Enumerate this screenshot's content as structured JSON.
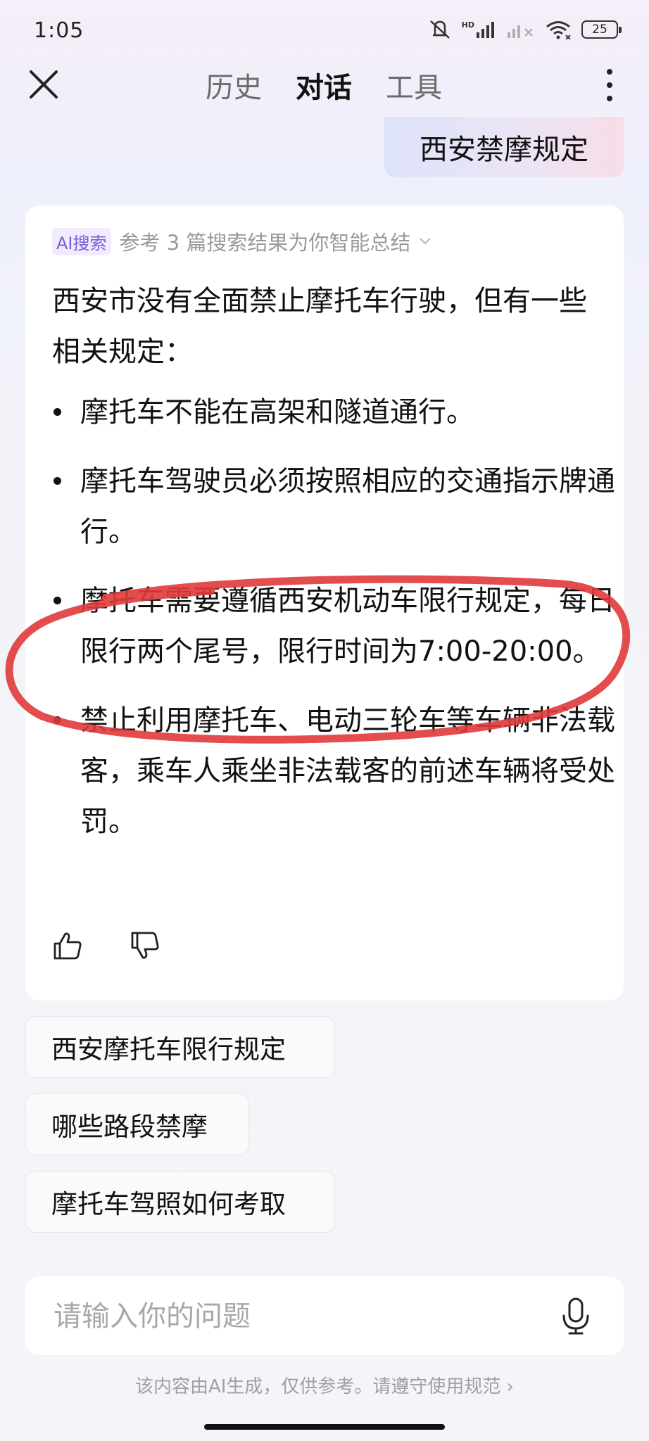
{
  "status_bar": {
    "time": "1:05",
    "hd_label": "HD",
    "battery": "25"
  },
  "nav": {
    "tabs": [
      "历史",
      "对话",
      "工具"
    ],
    "active_tab": "对话"
  },
  "user_message": "西安禁摩规定",
  "answer": {
    "ai_badge": "AI搜索",
    "source_summary": "参考 3 篇搜索结果为你智能总结",
    "intro": "西安市没有全面禁止摩托车行驶，但有一些相关规定：",
    "bullets": [
      "摩托车不能在高架和隧道通行。",
      "摩托车驾驶员必须按照相应的交通指示牌通行。",
      "摩托车需要遵循西安机动车限行规定，每日限行两个尾号，限行时间为7:00-20:00。",
      "禁止利用摩托车、电动三轮车等车辆非法载客，乘车人乘坐非法载客的前述车辆将受处罚。"
    ]
  },
  "suggestions": [
    "西安摩托车限行规定",
    "哪些路段禁摩",
    "摩托车驾照如何考取"
  ],
  "input": {
    "placeholder": "请输入你的问题"
  },
  "disclaimer": "该内容由AI生成，仅供参考。请遵守使用规范 ›",
  "annotation_color": "#e03a3a"
}
